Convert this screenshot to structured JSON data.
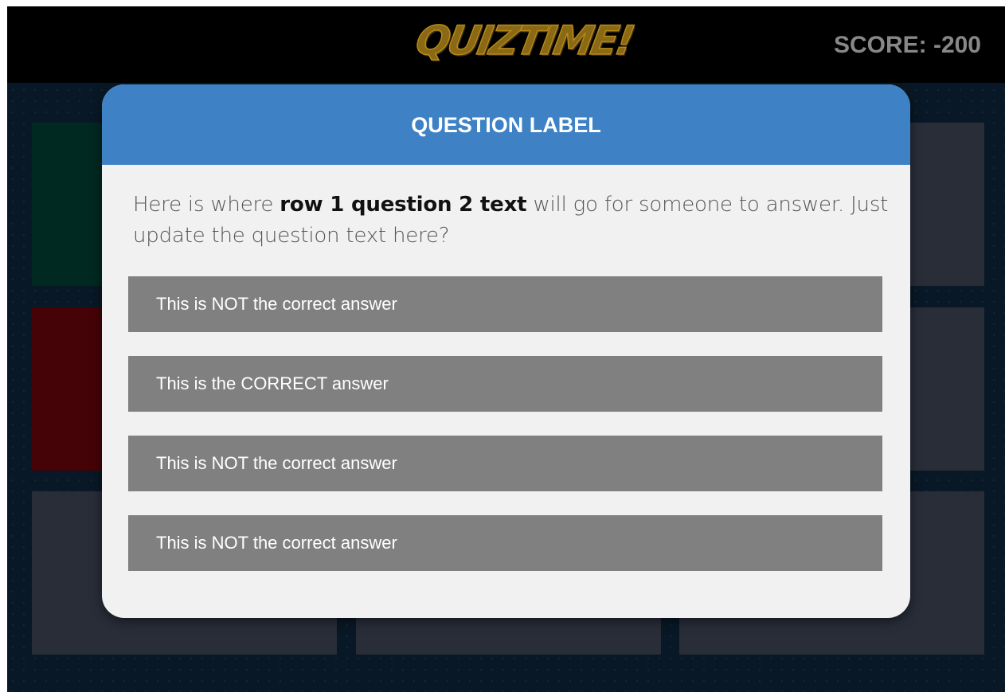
{
  "header": {
    "logo_text": "QUIZTIME!",
    "score_text": "SCORE: -200"
  },
  "modal": {
    "title": "QUESTION LABEL",
    "question": {
      "before": "Here is where ",
      "bold": "row 1 question 2 text",
      "after": " will go for someone to answer. Just update the question text here?"
    },
    "answers": [
      {
        "label": "This is NOT the correct answer"
      },
      {
        "label": "This is the CORRECT answer"
      },
      {
        "label": "This is NOT the correct answer"
      },
      {
        "label": "This is NOT the correct answer"
      }
    ]
  },
  "colors": {
    "topbar": "#000000",
    "background": "#0c1c2c",
    "modal_header": "#3e82c5",
    "modal_body": "#f1f1f1",
    "answer_button": "#808080",
    "tile_default": "#363944",
    "tile_green": "#013326",
    "tile_red": "#5c0103",
    "logo": "#8a6914",
    "score": "#888888"
  }
}
